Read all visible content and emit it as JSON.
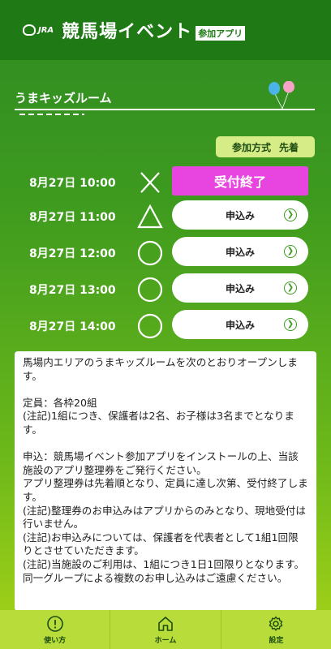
{
  "header": {
    "jra_logo": "JRA",
    "app_title": "競馬場イベント",
    "app_badge": "参加アプリ"
  },
  "section": {
    "title": "うまキッズルーム"
  },
  "entry_method": {
    "label": "参加方式",
    "value": "先着"
  },
  "slots": [
    {
      "time": "8月27日 10:00",
      "availability": "cross",
      "button": "受付終了",
      "closed": true
    },
    {
      "time": "8月27日 11:00",
      "availability": "triangle",
      "button": "申込み",
      "closed": false
    },
    {
      "time": "8月27日 12:00",
      "availability": "circle",
      "button": "申込み",
      "closed": false
    },
    {
      "time": "8月27日 13:00",
      "availability": "circle",
      "button": "申込み",
      "closed": false
    },
    {
      "time": "8月27日 14:00",
      "availability": "circle",
      "button": "申込み",
      "closed": false
    }
  ],
  "info_text": "馬場内エリアのうまキッズルームを次のとおりオープンします。\n\n定員：各枠20組\n(注記)1組につき、保護者は2名、お子様は3名までとなります。\n\n申込：競馬場イベント参加アプリをインストールの上、当該施設のアプリ整理券をご発行ください。\nアプリ整理券は先着順となり、定員に達し次第、受付終了します。\n(注記)整理券のお申込みはアプリからのみとなり、現地受付は行いません。\n(注記)お申込みについては、保護者を代表者として1組1回限りとさせていただきます。\n(注記)当施設のご利用は、1組につき1日1回限りとなります。同一グループによる複数のお申し込みはご遠慮ください。",
  "tabbar": {
    "items": [
      {
        "label": "使い方",
        "icon": "info-icon"
      },
      {
        "label": "ホーム",
        "icon": "home-icon"
      },
      {
        "label": "設定",
        "icon": "gear-icon"
      }
    ]
  },
  "colors": {
    "header": "#1f7a16",
    "closed_button": "#e845e0",
    "pill": "#d6ec86",
    "tabbar": "#b8dc3a"
  }
}
